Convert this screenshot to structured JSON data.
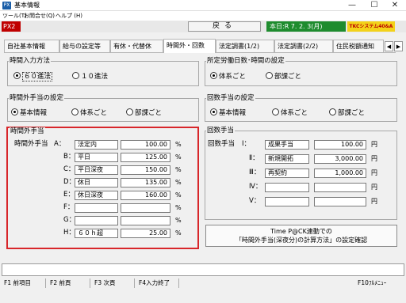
{
  "window": {
    "title": "基本情報",
    "app_icon": "PX",
    "controls": [
      "—",
      "☐",
      "✕"
    ]
  },
  "menubar": [
    "ツール(T)",
    "お問合せ(Q)",
    "ヘルプ (H)"
  ],
  "header": {
    "code": "PX2",
    "back_label": "戻る",
    "date": "本日:R 7. 2. 3(月)",
    "brand": "TKCシステム40&A",
    "accent": "#c00000",
    "date_bg": "#1e8c2e"
  },
  "tabs": [
    "自社基本情報",
    "給与の設定等",
    "有休・代替休",
    "時間外・回数",
    "法定調書(1/2)",
    "法定調書(2/2)",
    "住民税額通知"
  ],
  "active_tab": "時間外・回数",
  "groups": {
    "input_method": {
      "title": "時間入力方法",
      "options": [
        "６０進法",
        "１０進法"
      ],
      "selected": 0
    },
    "prescribed": {
      "title": "所定労働日数･時間の設定",
      "options": [
        "体系ごと",
        "部課ごと"
      ],
      "selected": 0
    },
    "overtime_setting": {
      "title": "時間外手当の設定",
      "options": [
        "基本情報",
        "体系ごと",
        "部課ごと"
      ],
      "selected": 0
    },
    "count_setting": {
      "title": "回数手当の設定",
      "options": [
        "基本情報",
        "体系ごと",
        "部課ごと"
      ],
      "selected": 0
    }
  },
  "overtime": {
    "title": "時間外手当",
    "row_prefix": "時間外手当",
    "unit": "%",
    "rows": [
      {
        "label": "A：",
        "name": "法定内",
        "rate": "100.00"
      },
      {
        "label": "B：",
        "name": "平日",
        "rate": "125.00"
      },
      {
        "label": "C：",
        "name": "平日深夜",
        "rate": "150.00"
      },
      {
        "label": "D：",
        "name": "休日",
        "rate": "135.00"
      },
      {
        "label": "E：",
        "name": "休日深夜",
        "rate": "160.00"
      },
      {
        "label": "F：",
        "name": "",
        "rate": ""
      },
      {
        "label": "G：",
        "name": "",
        "rate": ""
      },
      {
        "label": "H：",
        "name": "６０ｈ超",
        "rate": "25.00"
      }
    ]
  },
  "count": {
    "title": "回数手当",
    "row_prefix": "回数手当",
    "unit": "円",
    "rows": [
      {
        "label": "Ⅰ：",
        "name": "成果手当",
        "amount": "100.00"
      },
      {
        "label": "Ⅱ：",
        "name": "新規開拓",
        "amount": "3,000.00"
      },
      {
        "label": "Ⅲ：",
        "name": "再契約",
        "amount": "1,000.00"
      },
      {
        "label": "Ⅳ：",
        "name": "",
        "amount": ""
      },
      {
        "label": "Ⅴ：",
        "name": "",
        "amount": ""
      }
    ]
  },
  "confirm_button": {
    "line1": "Time P@CK連動での",
    "line2": "「時間外手当(深夜分)の計算方法」の設定確認"
  },
  "fkeys": [
    "F1 前項目",
    "F2 前頁",
    "F3 次頁",
    "F4入力終了",
    "F10ﾌﾙﾒﾆｭｰ"
  ]
}
